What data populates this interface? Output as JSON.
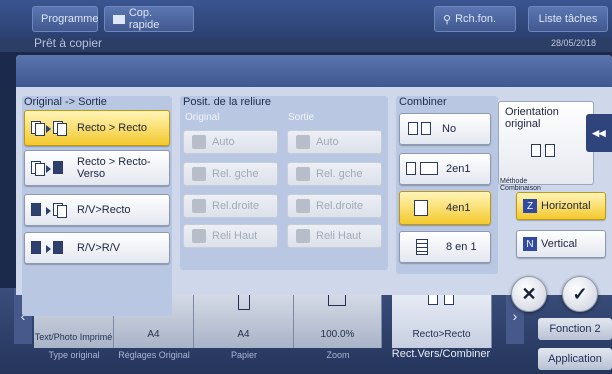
{
  "topbar": {
    "programme": "Programme",
    "cop_rapide": "Cop. rapide",
    "rch_fon": "Rch.fon.",
    "liste_taches": "Liste tâches"
  },
  "background": {
    "title": "Prêt à copier",
    "date": "28/05/2018"
  },
  "groups": {
    "original_sortie": {
      "title": "Original -> Sortie",
      "options": [
        "Recto > Recto",
        "Recto > Recto-Verso",
        "R/V>Recto",
        "R/V>R/V"
      ],
      "selected": "Recto > Recto"
    },
    "reliure": {
      "title": "Posit. de la reliure",
      "original_label": "Original",
      "sortie_label": "Sortie",
      "original_options": [
        "Auto",
        "Rel. gche",
        "Rel.droite",
        "Reli Haut"
      ],
      "sortie_options": [
        "Auto",
        "Rel. gche",
        "Rel.droite",
        "Reli Haut"
      ]
    },
    "combiner": {
      "title": "Combiner",
      "options": [
        "No",
        "2en1",
        "4en1",
        "8 en 1"
      ],
      "selected": "4en1"
    },
    "orientation": {
      "title": "Orientation original",
      "methode_label": "Méthode Combinaison",
      "methods": [
        "Horizontal",
        "Vertical"
      ],
      "selected": "Horizontal"
    }
  },
  "actions": {
    "cancel": "✕",
    "ok": "✓",
    "collapse": "◂◂"
  },
  "bottom": {
    "tiles": [
      {
        "value": "Text/Photo Imprimé",
        "label": "Type original"
      },
      {
        "value": "A4",
        "label": "Réglages Original"
      },
      {
        "value": "A4",
        "label": "Papier"
      },
      {
        "value": "100.0%",
        "label": "Zoom"
      },
      {
        "value": "Recto>Recto",
        "label": "Rect.Vers/Combiner"
      }
    ],
    "fonction2": "Fonction 2",
    "application": "Application"
  },
  "colors": {
    "selected": "#f4c92d",
    "panel_header": "#4d66a0",
    "group_bg": "#b9c7e2"
  }
}
